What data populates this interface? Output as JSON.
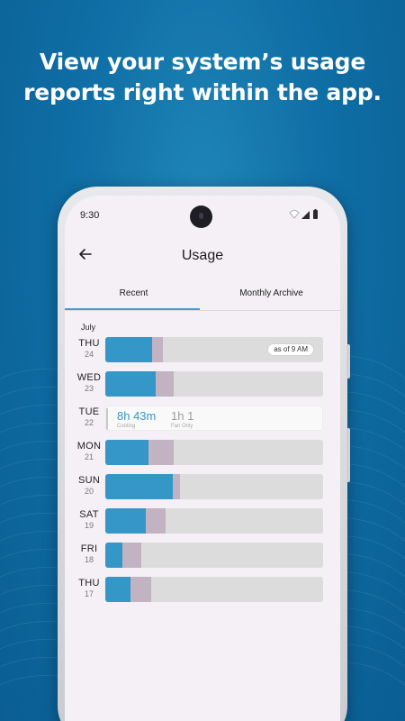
{
  "headline": {
    "line1": "View your system’s usage",
    "line2": "reports right within the app."
  },
  "status_bar": {
    "time": "9:30"
  },
  "app_bar": {
    "title": "Usage",
    "back_icon": "arrow-left-icon"
  },
  "tabs": [
    {
      "label": "Recent",
      "selected": true
    },
    {
      "label": "Monthly Archive",
      "selected": false
    }
  ],
  "month_label": "July",
  "colors": {
    "cooling": "#3497c8",
    "fan": "#c2b3c3",
    "track": "#dcdcdd",
    "accent": "#4a9cc9"
  },
  "days": [
    {
      "dow": "THU",
      "date": "24",
      "cooling_frac": 0.215,
      "fan_frac": 0.05,
      "badge": "as of 9 AM"
    },
    {
      "dow": "WED",
      "date": "23",
      "cooling_frac": 0.23,
      "fan_frac": 0.085
    },
    {
      "dow": "TUE",
      "date": "22",
      "selected": true,
      "cooling_value": "8h 43m",
      "cooling_label": "Cooling",
      "fan_value": "1h 1",
      "fan_label": "Fan Only"
    },
    {
      "dow": "MON",
      "date": "21",
      "cooling_frac": 0.2,
      "fan_frac": 0.115
    },
    {
      "dow": "SUN",
      "date": "20",
      "cooling_frac": 0.31,
      "fan_frac": 0.035
    },
    {
      "dow": "SAT",
      "date": "19",
      "cooling_frac": 0.185,
      "fan_frac": 0.09
    },
    {
      "dow": "FRI",
      "date": "18",
      "cooling_frac": 0.08,
      "fan_frac": 0.085
    },
    {
      "dow": "THU",
      "date": "17",
      "cooling_frac": 0.115,
      "fan_frac": 0.095
    }
  ]
}
